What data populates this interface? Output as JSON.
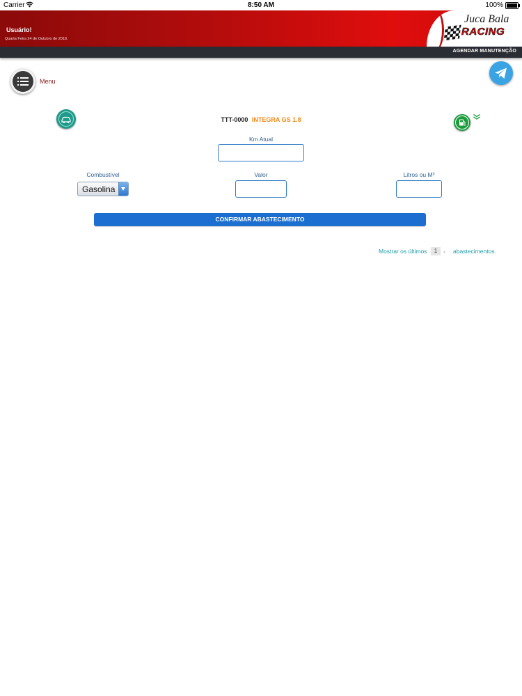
{
  "status_bar": {
    "carrier": "Carrier",
    "time": "8:50 AM",
    "battery": "100%"
  },
  "header": {
    "user": "Usuário!",
    "date": "Quarta Feira 24 de Outubro de 2018.",
    "logo_line1": "Juca Bala",
    "logo_line2": "RACING",
    "nav_link": "AGENDAR MANUTENÇÃO"
  },
  "menu": {
    "label": "Menu"
  },
  "vehicle": {
    "plate": "TTT-0000",
    "model": "INTEGRA GS 1.8"
  },
  "form": {
    "km_label": "Km Atual",
    "km_value": "",
    "fuel_label": "Combustível",
    "fuel_selected": "Gasolina",
    "value_label": "Valor",
    "value_value": "",
    "liters_label": "Litros ou M³",
    "liters_value": "",
    "confirm_label": "CONFIRMAR ABASTECIMENTO"
  },
  "history": {
    "prefix": "Mostrar os últimos",
    "count": "1",
    "suffix": "abastecimentos."
  },
  "colors": {
    "header_red": "#d10d0d",
    "navbar_dark": "#2a2d33",
    "primary_blue": "#1c6fd0",
    "accent_orange": "#f28a1a",
    "teal_link": "#1f9aa9"
  },
  "icons": {
    "menu": "list-icon",
    "send": "send-icon",
    "car": "car-icon",
    "fuel": "fuel-pump-icon",
    "expand": "double-chevron-down-icon"
  }
}
